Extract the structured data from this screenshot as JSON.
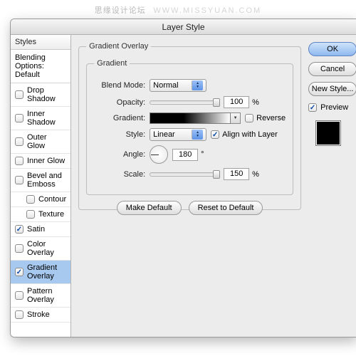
{
  "watermark": {
    "cn": "思缘设计论坛",
    "en": "WWW.MISSYUAN.COM"
  },
  "window": {
    "title": "Layer Style"
  },
  "sidebar": {
    "header": "Styles",
    "subheader": "Blending Options: Default",
    "items": [
      {
        "label": "Drop Shadow",
        "checked": false,
        "indent": false
      },
      {
        "label": "Inner Shadow",
        "checked": false,
        "indent": false
      },
      {
        "label": "Outer Glow",
        "checked": false,
        "indent": false
      },
      {
        "label": "Inner Glow",
        "checked": false,
        "indent": false
      },
      {
        "label": "Bevel and Emboss",
        "checked": false,
        "indent": false
      },
      {
        "label": "Contour",
        "checked": false,
        "indent": true
      },
      {
        "label": "Texture",
        "checked": false,
        "indent": true
      },
      {
        "label": "Satin",
        "checked": true,
        "indent": false
      },
      {
        "label": "Color Overlay",
        "checked": false,
        "indent": false
      },
      {
        "label": "Gradient Overlay",
        "checked": true,
        "indent": false,
        "selected": true
      },
      {
        "label": "Pattern Overlay",
        "checked": false,
        "indent": false
      },
      {
        "label": "Stroke",
        "checked": false,
        "indent": false
      }
    ]
  },
  "panel": {
    "outer_legend": "Gradient Overlay",
    "inner_legend": "Gradient",
    "blend_mode": {
      "label": "Blend Mode:",
      "value": "Normal"
    },
    "opacity": {
      "label": "Opacity:",
      "value": "100",
      "unit": "%",
      "pct": 100
    },
    "gradient": {
      "label": "Gradient:",
      "reverse_label": "Reverse",
      "reverse_checked": false
    },
    "style": {
      "label": "Style:",
      "value": "Linear",
      "align_label": "Align with Layer",
      "align_checked": true
    },
    "angle": {
      "label": "Angle:",
      "value": "180",
      "unit": "°"
    },
    "scale": {
      "label": "Scale:",
      "value": "150",
      "unit": "%",
      "pct": 100
    },
    "make_default": "Make Default",
    "reset_default": "Reset to Default"
  },
  "right": {
    "ok": "OK",
    "cancel": "Cancel",
    "new_style": "New Style...",
    "preview_label": "Preview",
    "preview_checked": true
  }
}
